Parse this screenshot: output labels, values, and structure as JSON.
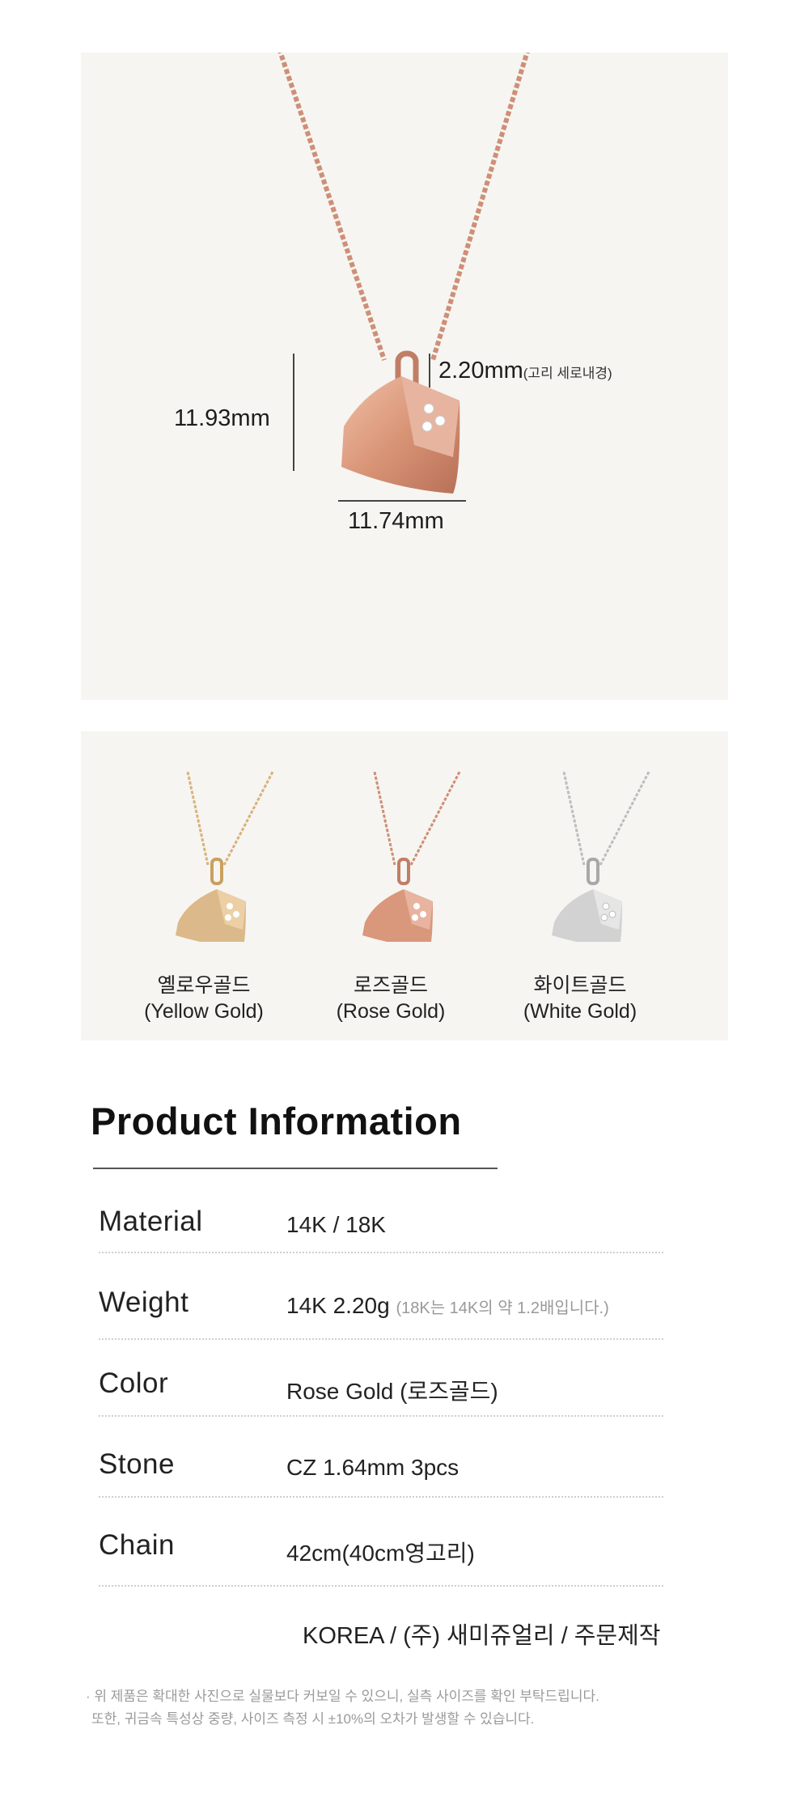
{
  "hero": {
    "height_label": "11.93mm",
    "bail_label": "2.20mm",
    "bail_note": "(고리 세로내경)",
    "width_label": "11.74mm"
  },
  "variants": [
    {
      "name_ko": "옐로우골드",
      "name_en": "(Yellow Gold)",
      "color": "#d9b27a"
    },
    {
      "name_ko": "로즈골드",
      "name_en": "(Rose Gold)",
      "color": "#d79a80"
    },
    {
      "name_ko": "화이트골드",
      "name_en": "(White Gold)",
      "color": "#c9c9c9"
    }
  ],
  "info": {
    "title": "Product Information",
    "rows": [
      {
        "key": "Material",
        "value": "14K / 18K",
        "note": ""
      },
      {
        "key": "Weight",
        "value": "14K 2.20g",
        "note": "(18K는 14K의 약 1.2배입니다.)"
      },
      {
        "key": "Color",
        "value": "Rose Gold (로즈골드)",
        "note": ""
      },
      {
        "key": "Stone",
        "value": "CZ 1.64mm 3pcs",
        "note": ""
      },
      {
        "key": "Chain",
        "value": "42cm(40cm영고리)",
        "note": ""
      }
    ],
    "origin": "KOREA / (주) 새미쥬얼리 / 주문제작",
    "notice_1": "· 위 제품은 확대한 사진으로 실물보다 커보일 수 있으니, 실측 사이즈를 확인 부탁드립니다.",
    "notice_2": "또한, 귀금속 특성상 중량, 사이즈 측정 시 ±10%의 오차가 발생할 수 있습니다."
  },
  "colors": {
    "panel_bg": "#f6f5f2",
    "rose_gold": "#d79a80",
    "yellow_gold": "#d9b27a",
    "white_gold": "#c9c9c9"
  }
}
